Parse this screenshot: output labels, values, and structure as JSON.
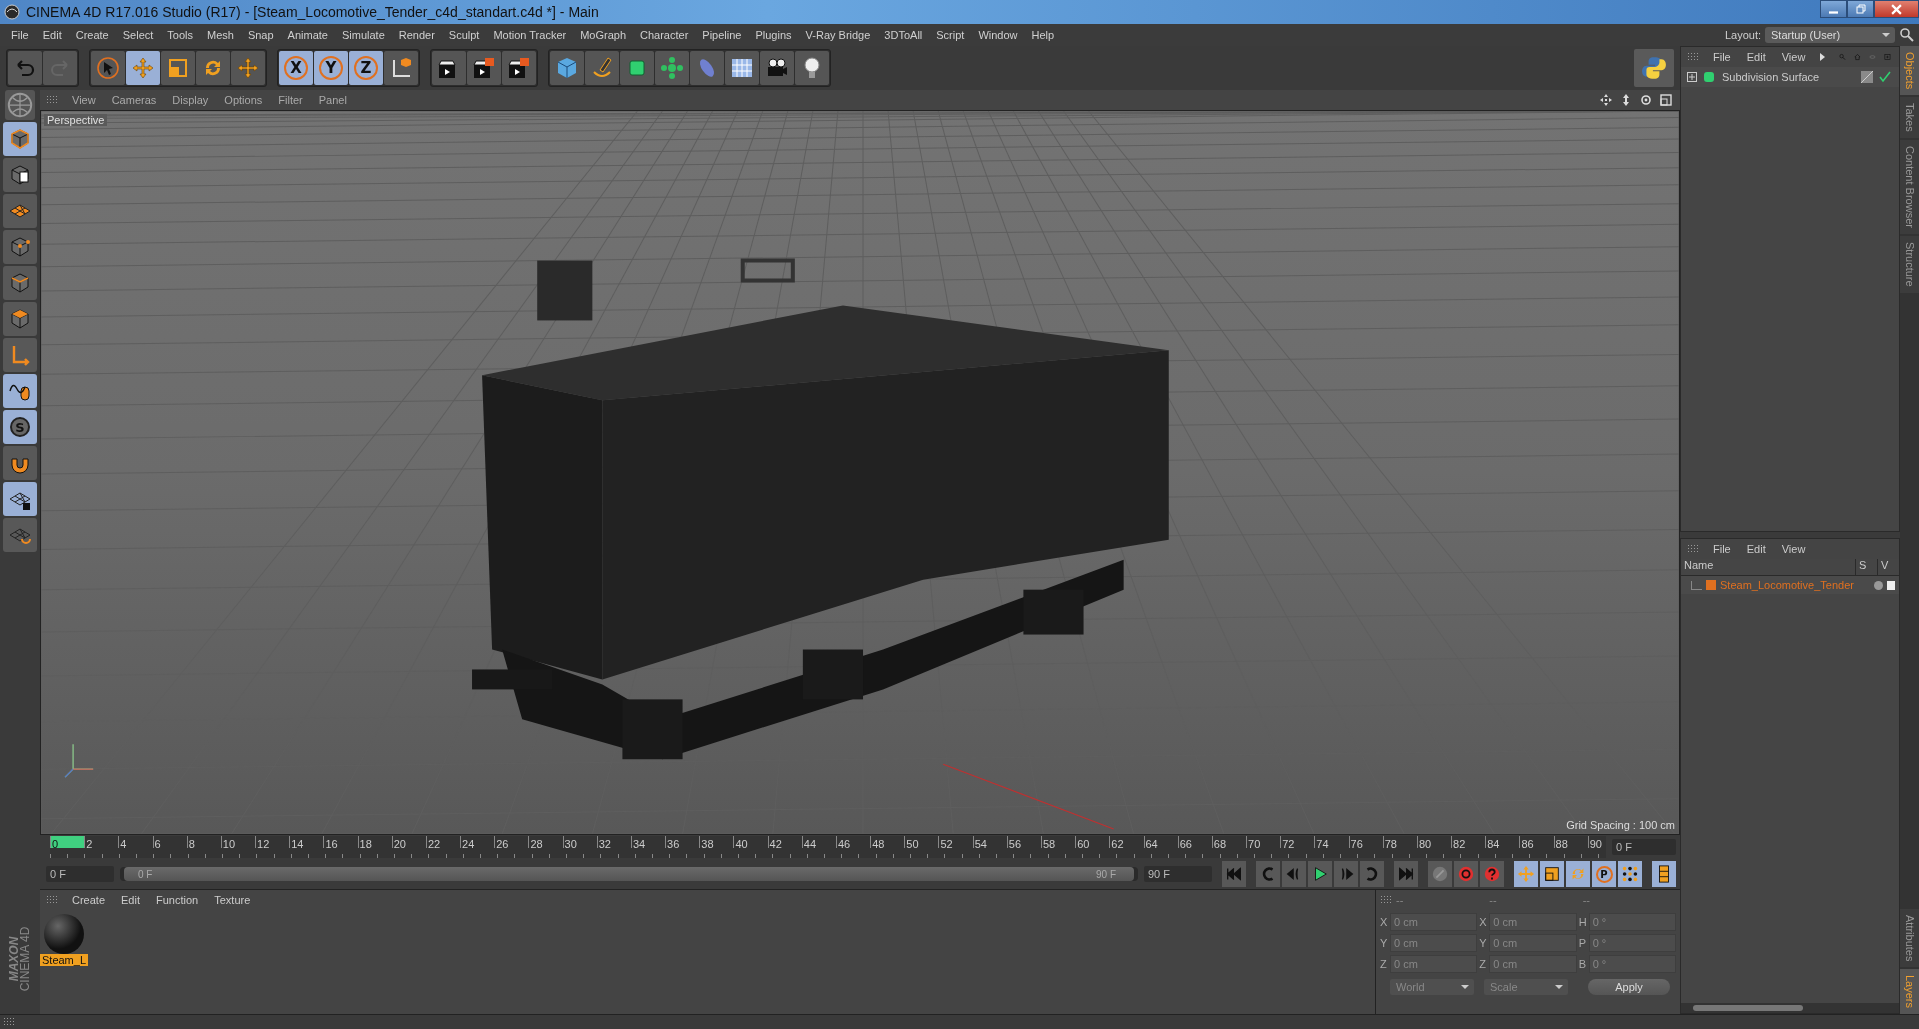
{
  "window": {
    "title": "CINEMA 4D R17.016 Studio (R17) - [Steam_Locomotive_Tender_c4d_standart.c4d *] - Main"
  },
  "menu": [
    "File",
    "Edit",
    "Create",
    "Select",
    "Tools",
    "Mesh",
    "Snap",
    "Animate",
    "Simulate",
    "Render",
    "Sculpt",
    "Motion Tracker",
    "MoGraph",
    "Character",
    "Pipeline",
    "Plugins",
    "V-Ray Bridge",
    "3DToAll",
    "Script",
    "Window",
    "Help"
  ],
  "layout": {
    "label": "Layout:",
    "value": "Startup (User)"
  },
  "toolbar": [
    {
      "items": [
        {
          "kind": "undo",
          "selected": false
        },
        {
          "kind": "redo",
          "selected": false
        }
      ]
    },
    {
      "items": [
        {
          "kind": "select",
          "selected": false
        },
        {
          "kind": "move",
          "selected": true
        },
        {
          "kind": "scale",
          "selected": false
        },
        {
          "kind": "rotate",
          "selected": false
        },
        {
          "kind": "cross",
          "selected": false
        }
      ]
    },
    {
      "items": [
        {
          "kind": "axis",
          "label": "X",
          "selected": true
        },
        {
          "kind": "axis",
          "label": "Y",
          "selected": true
        },
        {
          "kind": "axis",
          "label": "Z",
          "selected": true
        },
        {
          "kind": "coords",
          "selected": false
        }
      ]
    },
    {
      "items": [
        {
          "kind": "render-view",
          "selected": false
        },
        {
          "kind": "render-picture",
          "selected": false
        },
        {
          "kind": "render-settings",
          "selected": false
        }
      ]
    },
    {
      "items": [
        {
          "kind": "cube",
          "selected": false
        },
        {
          "kind": "pen",
          "selected": false
        },
        {
          "kind": "subdivision",
          "selected": false
        },
        {
          "kind": "cloner",
          "selected": false
        },
        {
          "kind": "deformer",
          "selected": false
        },
        {
          "kind": "floor",
          "selected": false
        },
        {
          "kind": "camera",
          "selected": false
        },
        {
          "kind": "light",
          "selected": false
        }
      ]
    }
  ],
  "left_tools": [
    {
      "kind": "model",
      "selected": true
    },
    {
      "kind": "texture",
      "selected": false
    },
    {
      "kind": "workplane",
      "selected": false
    },
    {
      "kind": "points",
      "selected": false
    },
    {
      "kind": "edges",
      "selected": false
    },
    {
      "kind": "polygons",
      "selected": false
    },
    {
      "kind": "axis",
      "selected": false
    },
    {
      "kind": "tweak",
      "selected": true
    },
    {
      "kind": "snap",
      "label": "S",
      "selected": true
    },
    {
      "kind": "magnet",
      "selected": false
    },
    {
      "kind": "lock",
      "selected": true
    },
    {
      "kind": "planar",
      "selected": false
    }
  ],
  "logo": [
    "MAXON",
    "CINEMA 4D"
  ],
  "viewport": {
    "menu": [
      "View",
      "Cameras",
      "Display",
      "Options",
      "Filter",
      "Panel"
    ],
    "camera": "Perspective",
    "grid_spacing": "Grid Spacing : 100 cm"
  },
  "timeline": {
    "ruler": [
      "0",
      "2",
      "4",
      "6",
      "8",
      "10",
      "12",
      "14",
      "16",
      "18",
      "20",
      "22",
      "24",
      "26",
      "28",
      "30",
      "32",
      "34",
      "36",
      "38",
      "40",
      "42",
      "44",
      "46",
      "48",
      "50",
      "52",
      "54",
      "56",
      "58",
      "60",
      "62",
      "64",
      "66",
      "68",
      "70",
      "72",
      "74",
      "76",
      "78",
      "80",
      "82",
      "84",
      "86",
      "88",
      "90"
    ],
    "current": "0 F",
    "start": "0 F",
    "range_start": "0 F",
    "range_end": "90 F",
    "level": 1,
    "end": "90 F",
    "buttons": [
      {
        "kind": "first",
        "selected": false
      },
      {
        "kind": "prev-key",
        "selected": false
      },
      {
        "kind": "prev",
        "selected": false
      },
      {
        "kind": "play",
        "selected": false
      },
      {
        "kind": "next",
        "selected": false
      },
      {
        "kind": "next-key",
        "selected": false
      },
      {
        "kind": "last",
        "selected": false
      },
      {
        "kind": "record-off",
        "selected": false
      },
      {
        "kind": "record",
        "selected": false
      },
      {
        "kind": "help",
        "selected": false
      },
      {
        "kind": "move",
        "selected": true
      },
      {
        "kind": "scale",
        "selected": true
      },
      {
        "kind": "rotate",
        "selected": true
      },
      {
        "kind": "param",
        "label": "P",
        "selected": true
      },
      {
        "kind": "pla",
        "selected": true
      },
      {
        "kind": "film",
        "selected": true
      }
    ]
  },
  "materials": {
    "menu": [
      "Create",
      "Edit",
      "Function",
      "Texture"
    ],
    "items": [
      {
        "name": "Steam_L",
        "selected": true
      }
    ]
  },
  "coordinates": {
    "headers": [
      "--",
      "--",
      "--"
    ],
    "rows": [
      {
        "axis": "X",
        "position": "0 cm",
        "size_axis": "X",
        "size": "0 cm",
        "rot_axis": "H",
        "rotation": "0 °"
      },
      {
        "axis": "Y",
        "position": "0 cm",
        "size_axis": "Y",
        "size": "0 cm",
        "rot_axis": "P",
        "rotation": "0 °"
      },
      {
        "axis": "Z",
        "position": "0 cm",
        "size_axis": "Z",
        "size": "0 cm",
        "rot_axis": "B",
        "rotation": "0 °"
      }
    ],
    "space": "World",
    "mode": "Scale",
    "apply": "Apply"
  },
  "objects": {
    "menu": [
      "File",
      "Edit",
      "View"
    ],
    "items": [
      {
        "name": "Subdivision Surface",
        "enabled": true
      }
    ]
  },
  "layers": {
    "menu": [
      "File",
      "Edit",
      "View"
    ],
    "columns": [
      "Name",
      "S",
      "V"
    ],
    "items": [
      {
        "name": "Steam_Locomotive_Tender",
        "color": "#e07020"
      }
    ]
  },
  "side_tabs": [
    {
      "label": "Objects",
      "selected": true
    },
    {
      "label": "Takes",
      "selected": false
    },
    {
      "label": "Content Browser",
      "selected": false
    },
    {
      "label": "Structure",
      "selected": false
    }
  ],
  "side_tabs_lower": [
    {
      "label": "Attributes",
      "selected": false
    },
    {
      "label": "Layers",
      "selected": true
    }
  ]
}
